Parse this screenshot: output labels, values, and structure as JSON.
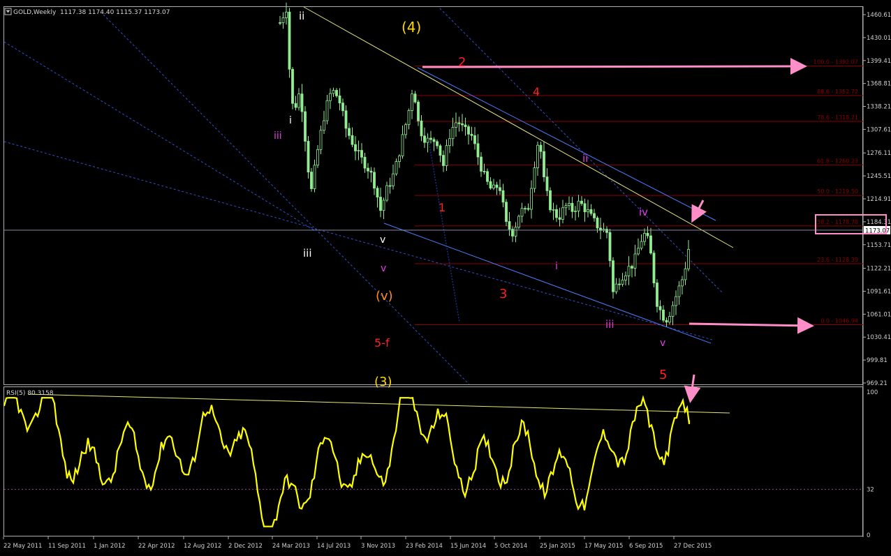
{
  "header": {
    "symbol_tf": "GOLD,Weekly",
    "ohlc": "1117.38 1174.40 1115.37 1173.07",
    "menu_icon": "dropdown-triangle-icon"
  },
  "price_axis": {
    "ticks": [
      "1460.61",
      "1430.01",
      "1399.41",
      "1368.81",
      "1338.21",
      "1307.61",
      "1276.11",
      "1245.51",
      "1214.91",
      "1184.31",
      "1153.71",
      "1122.21",
      "1091.61",
      "1061.01",
      "1030.41",
      "999.81",
      "969.21"
    ],
    "tick_values": [
      1460.61,
      1430.01,
      1399.41,
      1368.81,
      1338.21,
      1307.61,
      1276.11,
      1245.51,
      1214.91,
      1184.31,
      1153.71,
      1122.21,
      1091.61,
      1061.01,
      1030.41,
      999.81,
      969.21
    ],
    "current_price_label": "1173.07",
    "current_price": 1173.07
  },
  "fib_levels": [
    {
      "label": "100.0 - 1392.07",
      "value": 1392.07
    },
    {
      "label": "88.6 - 1352.72",
      "value": 1352.72
    },
    {
      "label": "78.6 - 1318.21",
      "value": 1318.21
    },
    {
      "label": "61.8 - 1260.23",
      "value": 1260.23
    },
    {
      "label": "50.0 - 1219.50",
      "value": 1219.5
    },
    {
      "label": "38.2 - 1178.78",
      "value": 1178.78
    },
    {
      "label": "23.6 - 1128.39",
      "value": 1128.39
    },
    {
      "label": "0.0 - 1046.94",
      "value": 1046.94
    }
  ],
  "time_axis": {
    "labels": [
      "22 May 2011",
      "11 Sep 2011",
      "1 Jan 2012",
      "22 Apr 2012",
      "12 Aug 2012",
      "2 Dec 2012",
      "24 Mar 2013",
      "14 Jul 2013",
      "3 Nov 2013",
      "23 Feb 2014",
      "15 Jun 2014",
      "5 Oct 2014",
      "25 Jan 2015",
      "17 May 2015",
      "6 Sep 2015",
      "27 Dec 2015"
    ]
  },
  "wave_labels": [
    {
      "text": "ii",
      "color": "#ffffff"
    },
    {
      "text": "(4)",
      "color": "#ffd700"
    },
    {
      "text": "i",
      "color": "#ffffff"
    },
    {
      "text": "iii",
      "color": "#e040e0"
    },
    {
      "text": "2",
      "color": "#ff2020"
    },
    {
      "text": "4",
      "color": "#ff2020"
    },
    {
      "text": "ii",
      "color": "#e040e0"
    },
    {
      "text": "1",
      "color": "#ff2020"
    },
    {
      "text": "iv",
      "color": "#e040e0"
    },
    {
      "text": "v",
      "color": "#ffffff"
    },
    {
      "text": "iii",
      "color": "#ffffff"
    },
    {
      "text": "v",
      "color": "#e040e0"
    },
    {
      "text": "i",
      "color": "#e040e0"
    },
    {
      "text": "(v)",
      "color": "#ff8c1a"
    },
    {
      "text": "3",
      "color": "#ff2020"
    },
    {
      "text": "iii",
      "color": "#e040e0"
    },
    {
      "text": "v",
      "color": "#e040e0"
    },
    {
      "text": "5-f",
      "color": "#ff2020"
    },
    {
      "text": "5",
      "color": "#ff2020"
    },
    {
      "text": "(3)",
      "color": "#ffd700"
    }
  ],
  "rsi": {
    "label": "RSI(5) 80.3158",
    "period": 5,
    "last_value": 80.3158,
    "levels": [
      "100",
      "32",
      "0"
    ]
  },
  "colors": {
    "candles": "#90ee90",
    "rsi_line": "#ffff00",
    "fib": "#8b0000",
    "arrows": "#ff8dc8",
    "trend_blue": "#4a7fff",
    "trend_yellow": "#e6e67a"
  },
  "chart_data": [
    {
      "type": "candlestick",
      "title": "GOLD,Weekly",
      "x": [
        "22 May 2011",
        "11 Sep 2011",
        "1 Jan 2012",
        "22 Apr 2012",
        "12 Aug 2012",
        "2 Dec 2012",
        "24 Mar 2013",
        "14 Jul 2013",
        "3 Nov 2013",
        "23 Feb 2014",
        "15 Jun 2014",
        "5 Oct 2014",
        "25 Jan 2015",
        "17 May 2015",
        "6 Sep 2015",
        "27 Dec 2015"
      ],
      "series": [
        {
          "name": "GOLD,Weekly",
          "approx_close": [
            null,
            null,
            null,
            null,
            null,
            null,
            1420,
            1300,
            1250,
            1330,
            1310,
            1200,
            1260,
            1180,
            1140,
            1173
          ]
        }
      ],
      "ylim": [
        969.21,
        1470
      ],
      "last_close": 1173.07
    },
    {
      "type": "line",
      "title": "RSI(5) 80.3158",
      "x": [
        "22 May 2011",
        "11 Sep 2011",
        "1 Jan 2012",
        "22 Apr 2012",
        "12 Aug 2012",
        "2 Dec 2012",
        "24 Mar 2013",
        "14 Jul 2013",
        "3 Nov 2013",
        "23 Feb 2014",
        "15 Jun 2014",
        "5 Oct 2014",
        "25 Jan 2015",
        "17 May 2015",
        "6 Sep 2015",
        "27 Dec 2015"
      ],
      "series": [
        {
          "name": "RSI(5)",
          "values": [
            72,
            86,
            50,
            45,
            70,
            65,
            25,
            40,
            45,
            88,
            55,
            60,
            40,
            50,
            60,
            80
          ]
        }
      ],
      "ylim": [
        0,
        100
      ],
      "reference_lines": [
        32
      ]
    }
  ]
}
